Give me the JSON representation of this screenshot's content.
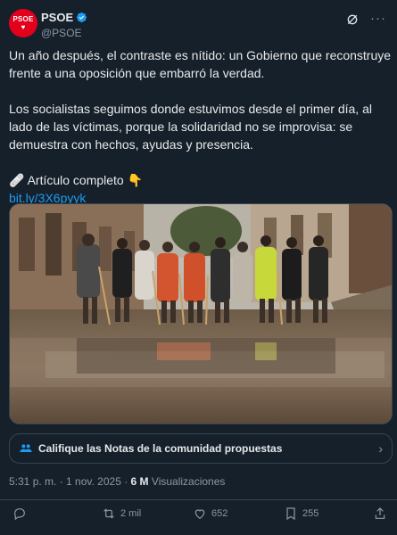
{
  "account": {
    "display_name": "PSOE",
    "handle": "@PSOE",
    "avatar_text": "PSOE",
    "avatar_color": "#e3001b",
    "verified": true
  },
  "tweet": {
    "paragraph1": "Un año después, el contraste es nítido: un Gobierno que reconstruye frente a una oposición que embarró la verdad.",
    "paragraph2": "Los socialistas seguimos donde estuvimos desde el primer día, al lado de las víctimas, porque la solidaridad no se improvisa: se demuestra con hechos, ayudas y presencia.",
    "article_emoji": "🩹",
    "article_label": "Artículo completo",
    "article_pointer": "👇",
    "link": "bit.ly/3X6pyyk"
  },
  "media": {
    "icon": "flood-cleanup-photo"
  },
  "community_notes": {
    "label": "Califique las Notas de la comunidad propuestas"
  },
  "meta": {
    "time": "5:31 p. m.",
    "separator1": " · ",
    "date": "1 nov. 2025",
    "separator2": " · ",
    "views_count": "6 M",
    "views_label": "Visualizaciones"
  },
  "actions": {
    "reply_count": "",
    "retweet_count": "2 mil",
    "like_count": "652",
    "bookmark_count": "255"
  },
  "colors": {
    "background": "#15202b",
    "text": "#e7e9ea",
    "muted": "#8b98a5",
    "accent": "#1d9bf0",
    "border": "#38444d"
  }
}
